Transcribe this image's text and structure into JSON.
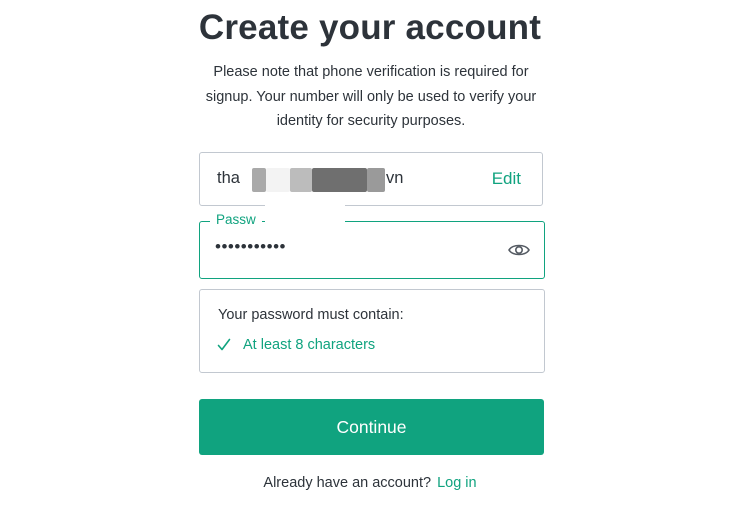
{
  "title": "Create your account",
  "subtitle": "Please note that phone verification is required for signup. Your number will only be used to verify your identity for security purposes.",
  "email": {
    "visible_prefix": "tha",
    "visible_suffix": "vn",
    "edit_label": "Edit"
  },
  "password": {
    "label": "Passw",
    "masked_value": "•••••••••••",
    "toggle_icon": "eye-icon"
  },
  "requirements": {
    "title": "Your password must contain:",
    "items": [
      {
        "label": "At least 8 characters",
        "met": true,
        "icon": "check-icon"
      }
    ]
  },
  "continue_label": "Continue",
  "footer": {
    "prompt": "Already have an account?",
    "login_label": "Log in"
  },
  "colors": {
    "accent": "#10a37f",
    "text": "#2d333a",
    "border": "#c2c8d0"
  }
}
